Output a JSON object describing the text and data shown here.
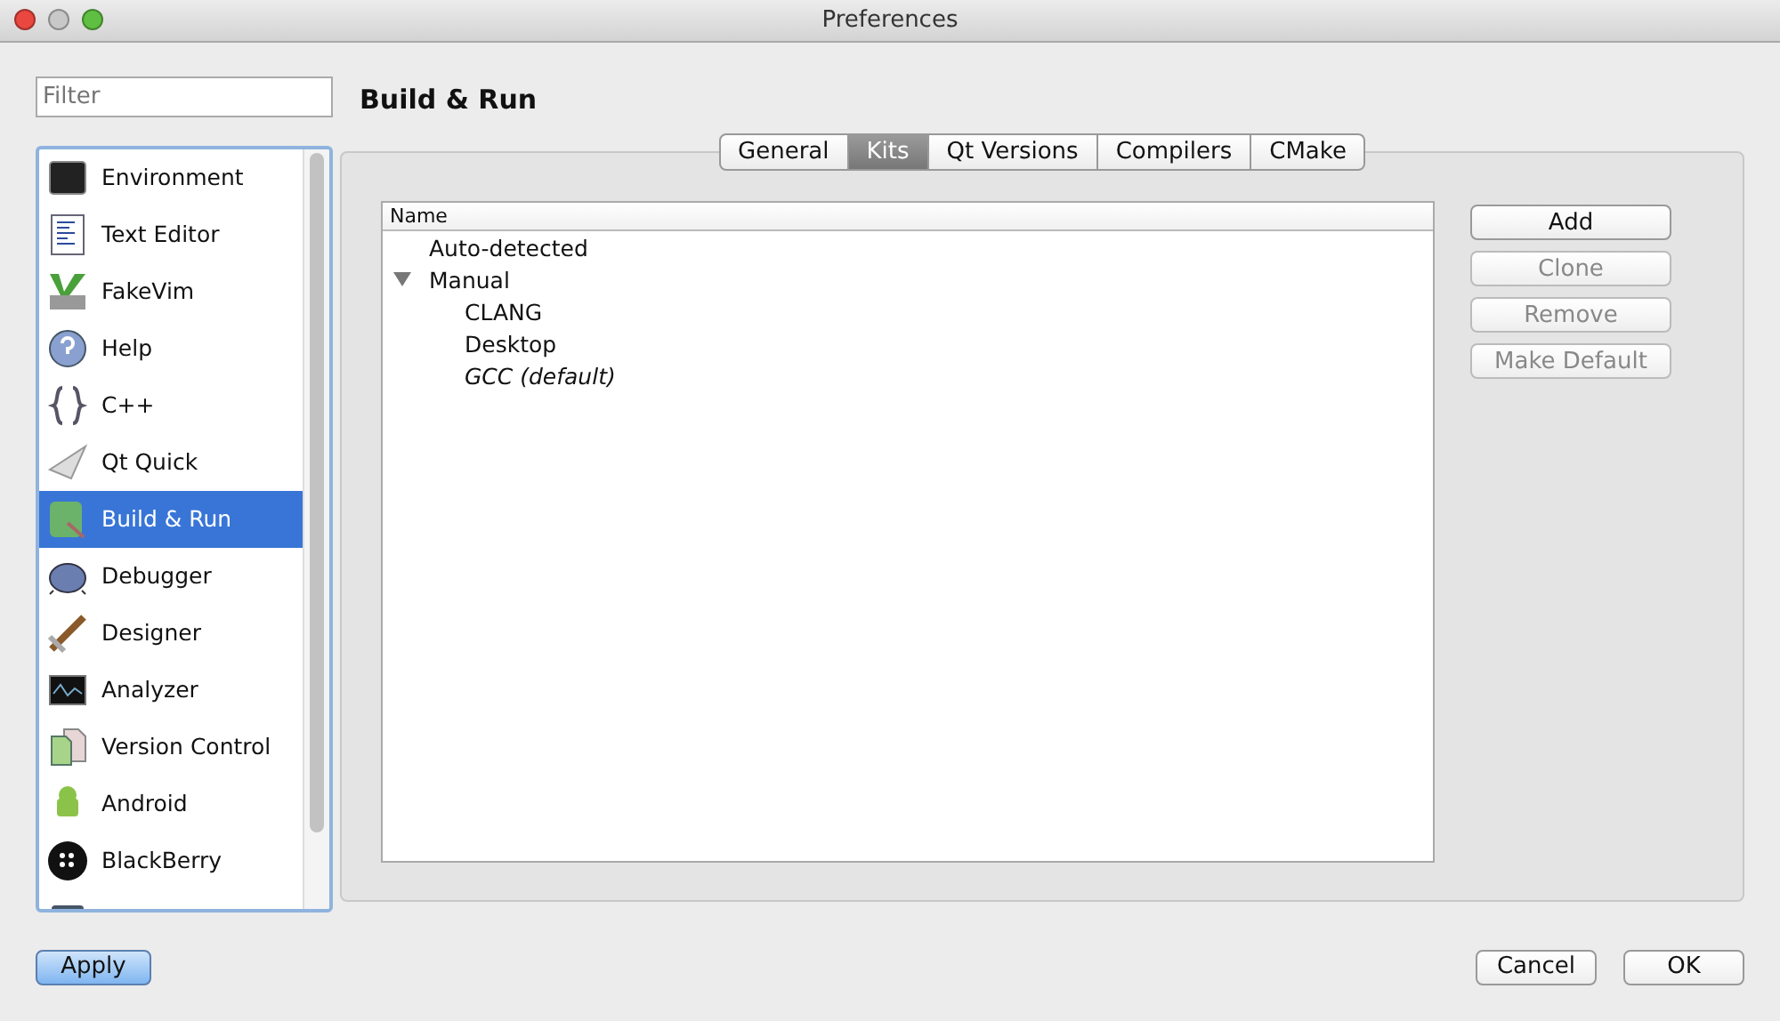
{
  "window": {
    "title": "Preferences"
  },
  "filter": {
    "placeholder": "Filter"
  },
  "sidebar": {
    "items": [
      {
        "label": "Environment",
        "selected": false
      },
      {
        "label": "Text Editor",
        "selected": false
      },
      {
        "label": "FakeVim",
        "selected": false
      },
      {
        "label": "Help",
        "selected": false
      },
      {
        "label": "C++",
        "selected": false
      },
      {
        "label": "Qt Quick",
        "selected": false
      },
      {
        "label": "Build & Run",
        "selected": true
      },
      {
        "label": "Debugger",
        "selected": false
      },
      {
        "label": "Designer",
        "selected": false
      },
      {
        "label": "Analyzer",
        "selected": false
      },
      {
        "label": "Version Control",
        "selected": false
      },
      {
        "label": "Android",
        "selected": false
      },
      {
        "label": "BlackBerry",
        "selected": false
      }
    ]
  },
  "page_title": "Build & Run",
  "tabs": [
    {
      "label": "General",
      "selected": false
    },
    {
      "label": "Kits",
      "selected": true
    },
    {
      "label": "Qt Versions",
      "selected": false
    },
    {
      "label": "Compilers",
      "selected": false
    },
    {
      "label": "CMake",
      "selected": false
    }
  ],
  "tree": {
    "column": "Name",
    "items": [
      {
        "label": "Auto-detected",
        "italic": false
      },
      {
        "label": "Manual",
        "italic": false,
        "expanded": true,
        "children": [
          {
            "label": "CLANG",
            "italic": false
          },
          {
            "label": "Desktop",
            "italic": false
          },
          {
            "label": "GCC (default)",
            "italic": true
          }
        ]
      }
    ]
  },
  "side_buttons": [
    {
      "label": "Add",
      "disabled": false
    },
    {
      "label": "Clone",
      "disabled": true
    },
    {
      "label": "Remove",
      "disabled": true
    },
    {
      "label": "Make Default",
      "disabled": true
    }
  ],
  "footer": {
    "apply": "Apply",
    "cancel": "Cancel",
    "ok": "OK"
  }
}
